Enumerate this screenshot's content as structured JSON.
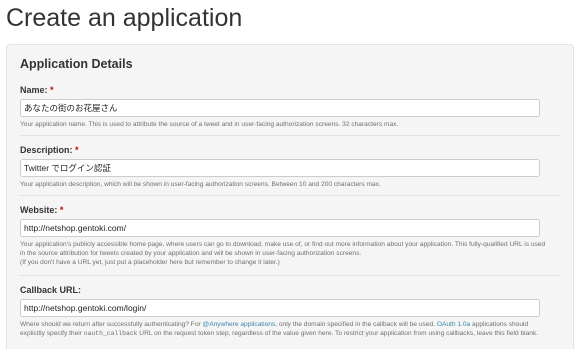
{
  "page": {
    "title": "Create an application"
  },
  "details": {
    "title": "Application Details",
    "name": {
      "label": "Name:",
      "required_mark": "*",
      "value": "あなたの街のお花屋さん",
      "help": "Your application name. This is used to attribute the source of a tweet and in user-facing authorization screens. 32 characters max."
    },
    "description": {
      "label": "Description:",
      "required_mark": "*",
      "value": "Twitter でログイン認証",
      "help": "Your application description, which will be shown in user-facing authorization screens. Between 10 and 200 characters max."
    },
    "website": {
      "label": "Website:",
      "required_mark": "*",
      "value": "http://netshop.gentoki.com/",
      "help_1": "Your application's publicly accessible home page, where users can go to download, make use of, or find out more information about your application. This fully-qualified URL is used in the source attribution for tweets created by your application and will be shown in user-facing authorization screens.",
      "help_2": "(If you don't have a URL yet, just put a placeholder here but remember to change it later.)"
    },
    "callback": {
      "label": "Callback URL:",
      "value": "http://netshop.gentoki.com/login/",
      "help_a": "Where should we return after successfully authenticating? For ",
      "help_link_1": "@Anywhere applications",
      "help_b": ", only the domain specified in the callback will be used. ",
      "help_link_2": "OAuth 1.0a",
      "help_c": " applications should explicitly specify their ",
      "help_code": "oauth_callback",
      "help_d": " URL on the request token step, regardless of the value given here. To restrict your application from using callbacks, leave this field blank."
    }
  },
  "colors": {
    "required": "#cc0000",
    "link": "#3a87ad",
    "panel_bg": "#f5f5f5"
  }
}
